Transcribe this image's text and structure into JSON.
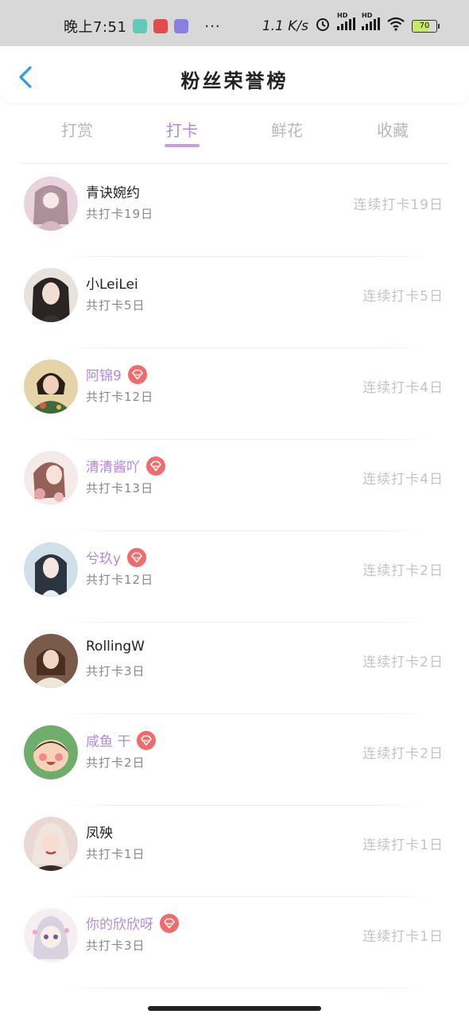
{
  "status_bar": {
    "time": "晚上7:51",
    "dots": "···",
    "speed": "1.1 K/s",
    "battery": "70",
    "hd1": "HD",
    "hd2": "HD"
  },
  "header": {
    "title": "粉丝荣誉榜",
    "back_icon": "chevron-left-icon"
  },
  "tabs": [
    {
      "label": "打赏",
      "active": false
    },
    {
      "label": "打卡",
      "active": true
    },
    {
      "label": "鲜花",
      "active": false
    },
    {
      "label": "收藏",
      "active": false
    }
  ],
  "colors": {
    "accent": "#b088e0",
    "vip_name": "#b48ae0",
    "vip_badge": "#f26b6b",
    "muted": "#c4c4c4"
  },
  "fans": [
    {
      "name": "青诀婉约",
      "vip": false,
      "total": "共打卡19日",
      "streak": "连续打卡19日"
    },
    {
      "name": "小LeiLei",
      "vip": false,
      "total": "共打卡5日",
      "streak": "连续打卡5日"
    },
    {
      "name": "阿锦9",
      "vip": true,
      "total": "共打卡12日",
      "streak": "连续打卡4日"
    },
    {
      "name": "清清酱吖",
      "vip": true,
      "total": "共打卡13日",
      "streak": "连续打卡4日"
    },
    {
      "name": "兮玖y",
      "vip": true,
      "total": "共打卡12日",
      "streak": "连续打卡2日"
    },
    {
      "name": "RollingW",
      "vip": false,
      "total": "共打卡3日",
      "streak": "连续打卡2日"
    },
    {
      "name": "咸鱼 干",
      "vip": true,
      "total": "共打卡2日",
      "streak": "连续打卡2日"
    },
    {
      "name": "凤殃",
      "vip": false,
      "total": "共打卡1日",
      "streak": "连续打卡1日"
    },
    {
      "name": "你的欣欣呀",
      "vip": true,
      "total": "共打卡3日",
      "streak": "连续打卡1日"
    }
  ]
}
